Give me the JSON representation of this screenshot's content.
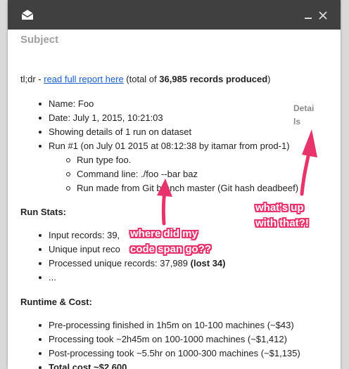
{
  "window": {
    "subject": "Subject"
  },
  "email": {
    "tldr_prefix": "tl;dr - ",
    "tldr_link": "read full report here",
    "tldr_mid": " (total of ",
    "tldr_total": "36,985 records produced",
    "tldr_suffix": ")",
    "details_link": "Details",
    "info_items": [
      "Name: Foo",
      "Date: July 1, 2015, 10:21:03",
      "Showing details of 1 run on dataset",
      "Run #1 (on July 01 2015 at 08:12:38 by itamar from prod-1)"
    ],
    "run_items": [
      "Run type foo.",
      "Command line: ./foo --bar baz",
      "Run made from Git branch master (Git hash deadbeef)"
    ],
    "run_stats_title": "Run Stats:",
    "run_stats": [
      "Input records: 39,",
      "Unique input reco",
      "Processed unique records: 37,989 ",
      "..."
    ],
    "run_stats_lost": "(lost 34)",
    "runtime_title": "Runtime & Cost:",
    "runtime": [
      "Pre-processing finished in 1h5m on 10-100 machines (~$43)",
      "Processing took ~2h45m on 100-1000 machines (~$1,412)",
      "Post-processing took ~5.5hr on 1000-300 machines (~$1,135)",
      "Total cost ~$2,600"
    ]
  },
  "annotations": {
    "code_span": [
      "where did my",
      "code span go??"
    ],
    "details": [
      "what's up",
      "with that?!"
    ],
    "color": "#e8336b"
  },
  "colors": {
    "titlebar": "#404040",
    "link": "#1a5fd1",
    "subject": "#9e9e9e"
  }
}
